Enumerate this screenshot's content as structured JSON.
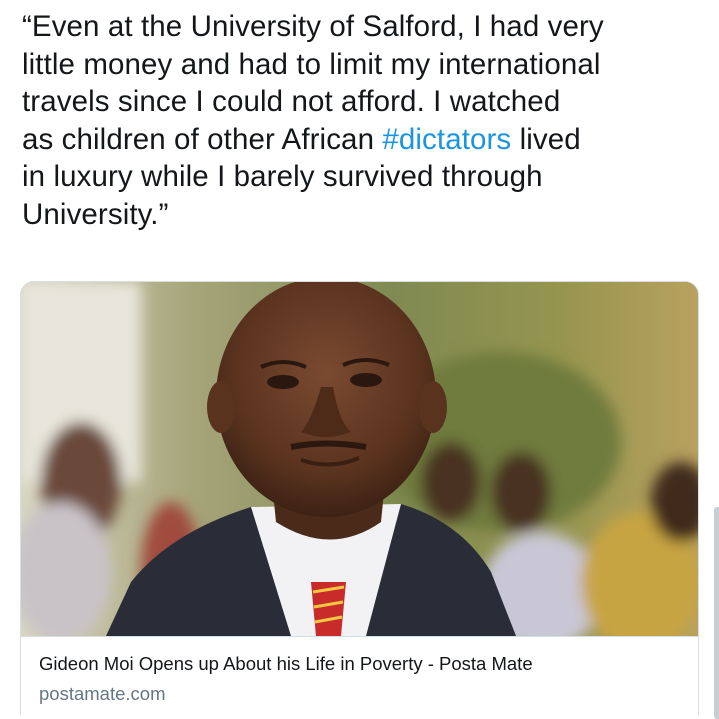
{
  "tweet": {
    "lines": [
      {
        "text": "“Even at the University of Salford, I had very"
      },
      {
        "text": "little money and had to limit my international"
      },
      {
        "text": "travels since I could not afford. I watched"
      },
      {
        "before": "as children of other African ",
        "hashtag": "#dictators",
        "after": " lived"
      },
      {
        "text": "in luxury while I barely survived through"
      },
      {
        "text": "University.”"
      }
    ],
    "hashtag_color": "#1b95e0",
    "text_color": "#14171a"
  },
  "link_card": {
    "image_subject": "photo of man in suit and red striped tie",
    "title": "Gideon Moi Opens up About his Life in Poverty - Posta Mate",
    "domain": "postamate.com",
    "domain_color": "#657786",
    "border_color": "#d6dde3"
  }
}
